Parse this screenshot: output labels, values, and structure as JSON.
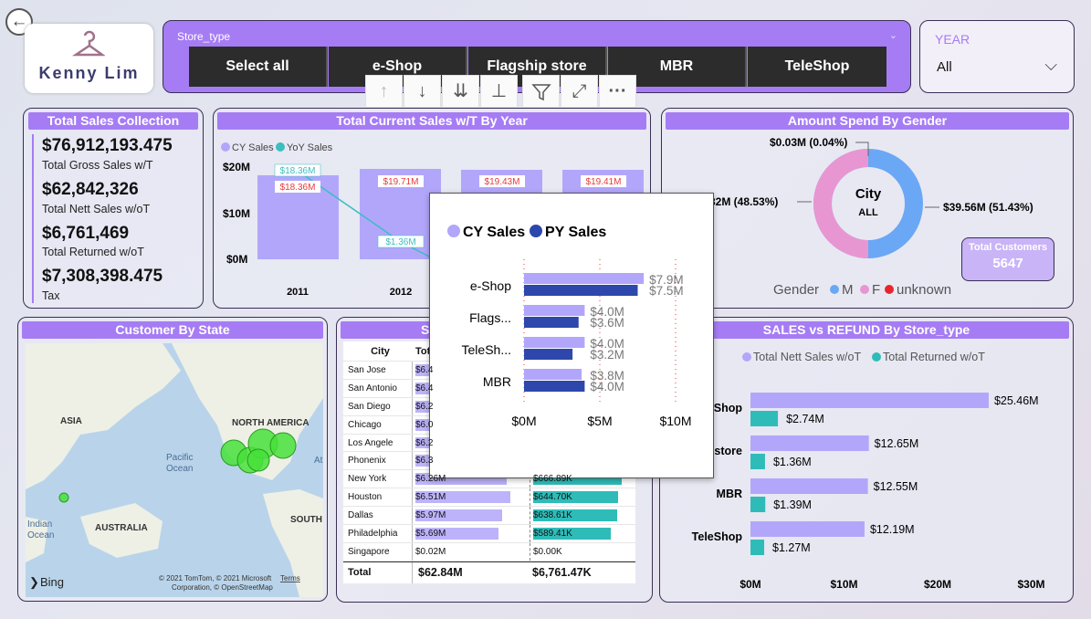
{
  "header": {
    "back_glyph": "←",
    "logo_text": "Kenny Lim",
    "store_type_label": "Store_type",
    "store_types": [
      "Select all",
      "e-Shop",
      "Flagship store",
      "MBR",
      "TeleShop"
    ],
    "year_label": "YEAR",
    "year_value": "All"
  },
  "toolbar": {
    "icons": [
      "sort-ascending-icon",
      "sort-descending-icon",
      "expand-all-icon",
      "drill-down-icon",
      "filter-icon",
      "focus-mode-icon",
      "more-options-icon"
    ],
    "glyphs": [
      "↑",
      "↓",
      "⇊",
      "⊥",
      "⏚",
      "⤢",
      "···"
    ]
  },
  "kpi": {
    "title": "Total Sales Collection",
    "items": [
      {
        "value": "$76,912,193.475",
        "label": "Total Gross Sales w/T"
      },
      {
        "value": "$62,842,326",
        "label": "Total Nett Sales w/oT"
      },
      {
        "value": "$6,761,469",
        "label": "Total Returned w/oT"
      },
      {
        "value": "$7,308,398.475",
        "label": "Tax"
      }
    ]
  },
  "year_chart": {
    "title": "Total Current Sales w/T By Year",
    "legend": [
      "CY Sales",
      "YoY Sales"
    ],
    "y_ticks": [
      "$20M",
      "$10M",
      "$0M"
    ],
    "years": [
      "2011",
      "2012"
    ],
    "cy_labels": [
      "$18.36M",
      "$19.71M",
      "$19.43M",
      "$19.41M"
    ],
    "yoy_labels": [
      "$18.36M",
      "$1.36M"
    ],
    "colors": {
      "cy": "#b2a6fb",
      "yoy": "#3cbdc0",
      "label": "#e83a3a"
    }
  },
  "gender": {
    "title": "Amount Spend By Gender",
    "center_title": "City",
    "center_value": "ALL",
    "labels": [
      "$0.03M (0.04%)",
      "2.32M (48.53%)",
      "$39.56M (51.43%)"
    ],
    "legend_title": "Gender",
    "legend": [
      "M",
      "F",
      "unknown"
    ],
    "customers_label": "Total Customers",
    "customers_value": "5647",
    "colors": {
      "M": "#6aa8f5",
      "F": "#e896d2",
      "unknown": "#e8252d"
    }
  },
  "map": {
    "title": "Customer By State",
    "labels": [
      "ASIA",
      "NORTH AMERICA",
      "Pacific",
      "Ocean",
      "Indian",
      "Ocean",
      "AUSTRALIA",
      "SOUTH",
      "At"
    ],
    "bing": "Bing",
    "copyright": "© 2021 TomTom, © 2021 Microsoft",
    "copyright2": "Corporation, © OpenStreetMap",
    "terms": "Terms"
  },
  "city_table": {
    "title": "S",
    "headers": [
      "City",
      "Tot"
    ],
    "rows": [
      {
        "city": "San Jose",
        "nett": "$6.4",
        "ret": "",
        "nett_frac": 0.95,
        "ret_frac": 0
      },
      {
        "city": "San Antonio",
        "nett": "$6.4",
        "ret": "",
        "nett_frac": 0.95,
        "ret_frac": 0
      },
      {
        "city": "San Diego",
        "nett": "$6.2",
        "ret": "",
        "nett_frac": 0.92,
        "ret_frac": 0
      },
      {
        "city": "Chicago",
        "nett": "$6.0",
        "ret": "",
        "nett_frac": 0.9,
        "ret_frac": 0
      },
      {
        "city": "Los Angele",
        "nett": "$6.2",
        "ret": "",
        "nett_frac": 0.92,
        "ret_frac": 0
      },
      {
        "city": "Phonenix",
        "nett": "$6.3",
        "ret": "",
        "nett_frac": 0.93,
        "ret_frac": 0
      },
      {
        "city": "New York",
        "nett": "$6.26M",
        "ret": "$666.89K",
        "nett_frac": 0.87,
        "ret_frac": 0.84
      },
      {
        "city": "Houston",
        "nett": "$6.51M",
        "ret": "$644.70K",
        "nett_frac": 0.9,
        "ret_frac": 0.81
      },
      {
        "city": "Dallas",
        "nett": "$5.97M",
        "ret": "$638.61K",
        "nett_frac": 0.83,
        "ret_frac": 0.8
      },
      {
        "city": "Philadelphia",
        "nett": "$5.69M",
        "ret": "$589.41K",
        "nett_frac": 0.79,
        "ret_frac": 0.74
      },
      {
        "city": "Singapore",
        "nett": "$0.02M",
        "ret": "$0.00K",
        "nett_frac": 0.0,
        "ret_frac": 0.0
      }
    ],
    "total_label": "Total",
    "total_nett": "$62.84M",
    "total_ret": "$6,761.47K"
  },
  "tooltip": {
    "legend": [
      "CY Sales",
      "PY Sales"
    ],
    "colors": {
      "cy": "#b2a6fb",
      "py": "#2e47ad"
    },
    "x_ticks": [
      "$0M",
      "$5M",
      "$10M"
    ],
    "rows": [
      {
        "label": "e-Shop",
        "cy": 7.9,
        "py": 7.5,
        "cy_label": "$7.9M",
        "py_label": "$7.5M"
      },
      {
        "label": "Flags...",
        "cy": 4.0,
        "py": 3.6,
        "cy_label": "$4.0M",
        "py_label": "$3.6M"
      },
      {
        "label": "TeleSh...",
        "cy": 4.0,
        "py": 3.2,
        "cy_label": "$4.0M",
        "py_label": "$3.2M"
      },
      {
        "label": "MBR",
        "cy": 3.8,
        "py": 4.0,
        "cy_label": "$3.8M",
        "py_label": "$4.0M"
      }
    ]
  },
  "refund": {
    "title": "SALES vs REFUND By Store_type",
    "legend": [
      "Total Nett Sales w/oT",
      "Total Returned w/oT"
    ],
    "colors": {
      "nett": "#b2a6fb",
      "ret": "#2fbcb8"
    },
    "x_ticks": [
      "$0M",
      "$10M",
      "$20M",
      "$30M"
    ],
    "rows": [
      {
        "label": "Shop",
        "nett": 25.46,
        "ret": 2.74,
        "nett_label": "$25.46M",
        "ret_label": "$2.74M"
      },
      {
        "label": "store",
        "nett": 12.65,
        "ret": 1.36,
        "nett_label": "$12.65M",
        "ret_label": "$1.36M"
      },
      {
        "label": "MBR",
        "nett": 12.55,
        "ret": 1.39,
        "nett_label": "$12.55M",
        "ret_label": "$1.39M"
      },
      {
        "label": "TeleShop",
        "nett": 12.19,
        "ret": 1.27,
        "nett_label": "$12.19M",
        "ret_label": "$1.27M"
      }
    ]
  }
}
